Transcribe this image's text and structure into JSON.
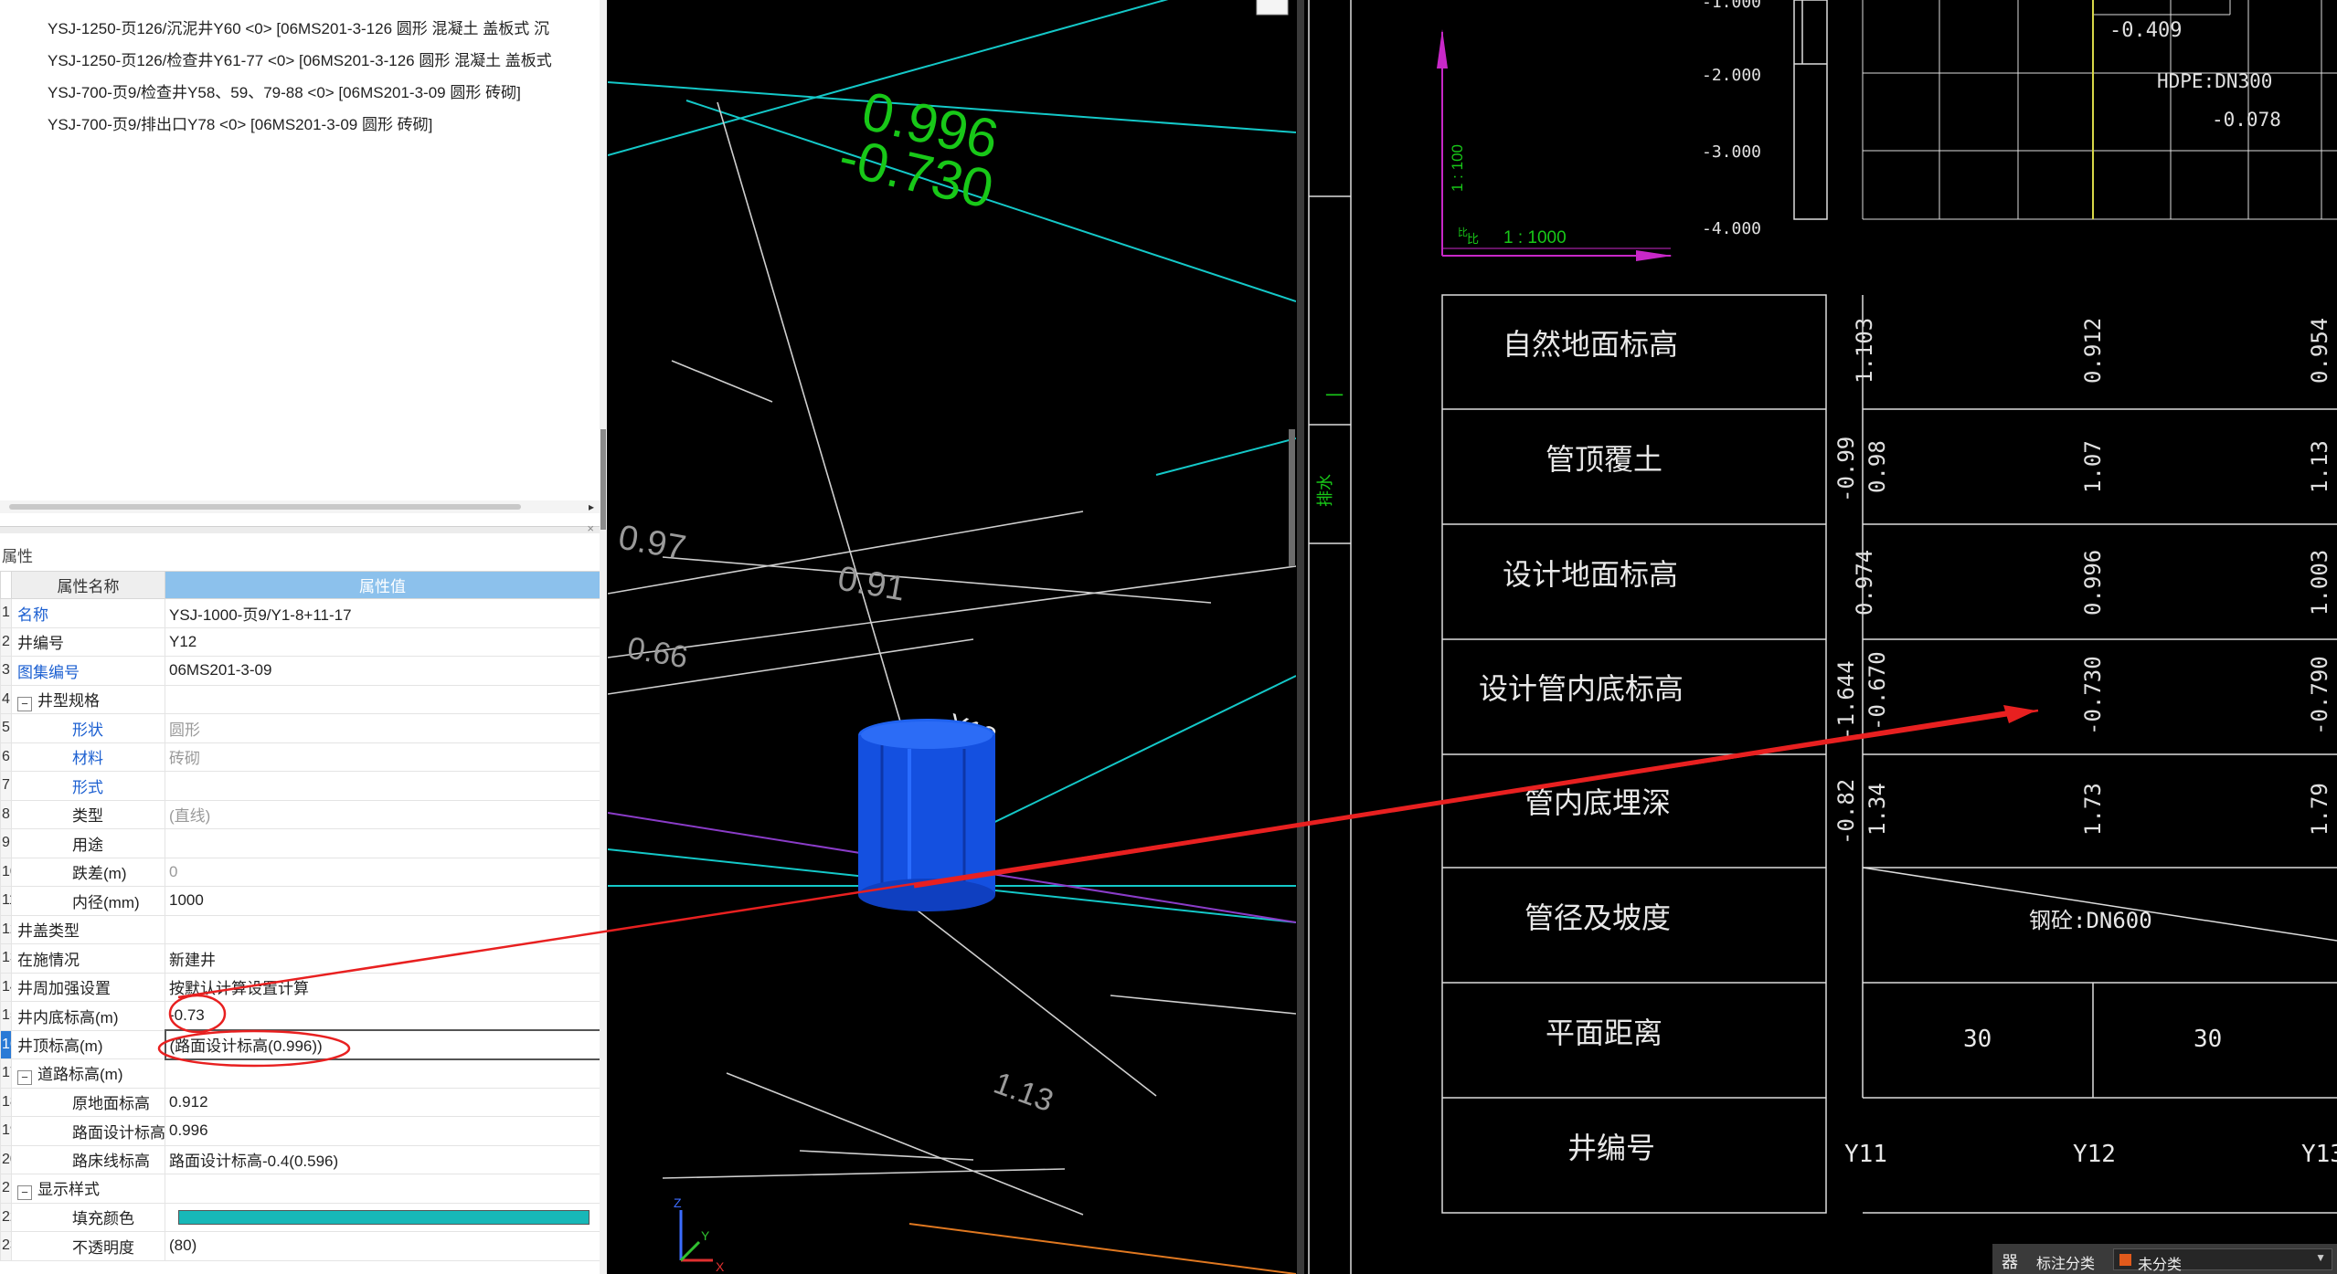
{
  "tree": {
    "items": [
      "YSJ-1250-页126/沉泥井Y60 <0> [06MS201-3-126 圆形 混凝土 盖板式 沉",
      "YSJ-1250-页126/检查井Y61-77 <0> [06MS201-3-126 圆形 混凝土 盖板式",
      "YSJ-700-页9/检查井Y58、59、79-88 <0> [06MS201-3-09 圆形 砖砌]",
      "YSJ-700-页9/排出口Y78 <0> [06MS201-3-09 圆形 砖砌]"
    ]
  },
  "properties": {
    "panel_title": "属性",
    "close_glyph": "×",
    "header_name": "属性名称",
    "header_value": "属性值",
    "rows": [
      {
        "num": "1",
        "name": "名称",
        "value": "YSJ-1000-页9/Y1-8+11-17"
      },
      {
        "num": "2",
        "name": "井编号",
        "value": "Y12"
      },
      {
        "num": "3",
        "name": "图集编号",
        "value": "06MS201-3-09"
      },
      {
        "num": "4",
        "toggle": "−",
        "name": "井型规格",
        "value": ""
      },
      {
        "num": "5",
        "name": "形状",
        "value": "圆形"
      },
      {
        "num": "6",
        "name": "材料",
        "value": "砖砌"
      },
      {
        "num": "7",
        "name": "形式",
        "value": ""
      },
      {
        "num": "8",
        "name": "类型",
        "value": "(直线)"
      },
      {
        "num": "9",
        "name": "用途",
        "value": ""
      },
      {
        "num": "10",
        "name": "跌差(m)",
        "value": "0"
      },
      {
        "num": "11",
        "name": "内径(mm)",
        "value": "1000"
      },
      {
        "num": "12",
        "name": "井盖类型",
        "value": ""
      },
      {
        "num": "13",
        "name": "在施情况",
        "value": "新建井"
      },
      {
        "num": "14",
        "name": "井周加强设置",
        "value": "按默认计算设置计算"
      },
      {
        "num": "15",
        "name": "井内底标高(m)",
        "value": "-0.73"
      },
      {
        "num": "16",
        "name": "井顶标高(m)",
        "value": "(路面设计标高(0.996))"
      },
      {
        "num": "17",
        "toggle": "−",
        "name": "道路标高(m)",
        "value": ""
      },
      {
        "num": "18",
        "name": "原地面标高",
        "value": "0.912"
      },
      {
        "num": "19",
        "name": "路面设计标高",
        "value": "0.996"
      },
      {
        "num": "20",
        "name": "路床线标高",
        "value": "路面设计标高-0.4(0.596)"
      },
      {
        "num": "21",
        "toggle": "−",
        "name": "显示样式",
        "value": ""
      },
      {
        "num": "22",
        "name": "填充颜色",
        "value": ""
      },
      {
        "num": "23",
        "name": "不透明度",
        "value": "(80)"
      }
    ]
  },
  "view3d": {
    "labels": {
      "green_top": "0.996",
      "green_bottom": "-0.730",
      "well_label": "Y12",
      "gray_1": "0.97",
      "gray_2": "0.91",
      "gray_3": "0.66",
      "gray_4": "1.13"
    },
    "axis": {
      "x": "X",
      "y": "Y",
      "z": "Z"
    },
    "well_color": "#1450e0",
    "green_color": "#18c818",
    "cyan_color": "#14c8c8"
  },
  "profile": {
    "elevation_ticks": [
      "-2.000",
      "-3.000",
      "-4.000",
      "-1.000"
    ],
    "scale_vertical": "1 : 100",
    "scale_horizontal": "1 : 1000",
    "scale_h_prefix": "比",
    "scale_v_prefix": "比",
    "side_label": "排水",
    "side_mark": "一",
    "top_value": "-0.409",
    "pipe_label": "HDPE:DN300",
    "pipe_value": "-0.078",
    "row_labels": [
      "自然地面标高",
      "管顶覆土",
      "设计地面标高",
      "设计管内底标高",
      "管内底埋深",
      "管径及坡度",
      "平面距离",
      "井编号"
    ],
    "natural_ground": [
      "1.103",
      "0.912",
      "0.954"
    ],
    "cover": [
      "-0.99",
      "0.98",
      "1.07",
      "1.13"
    ],
    "design_ground": [
      "0.974",
      "0.996",
      "1.003"
    ],
    "invert": [
      "-1.644",
      "-0.670",
      "-0.730",
      "-0.790"
    ],
    "depth": [
      "-0.82",
      "1.34",
      "1.73",
      "1.79"
    ],
    "pipe_size": "钢砼:DN600",
    "distance": [
      "30",
      "30"
    ],
    "wells": [
      "Y11",
      "Y12",
      "Y13"
    ]
  },
  "status": {
    "icon": "器",
    "label": "标注分类",
    "selected": "未分类",
    "caret": "▼"
  }
}
